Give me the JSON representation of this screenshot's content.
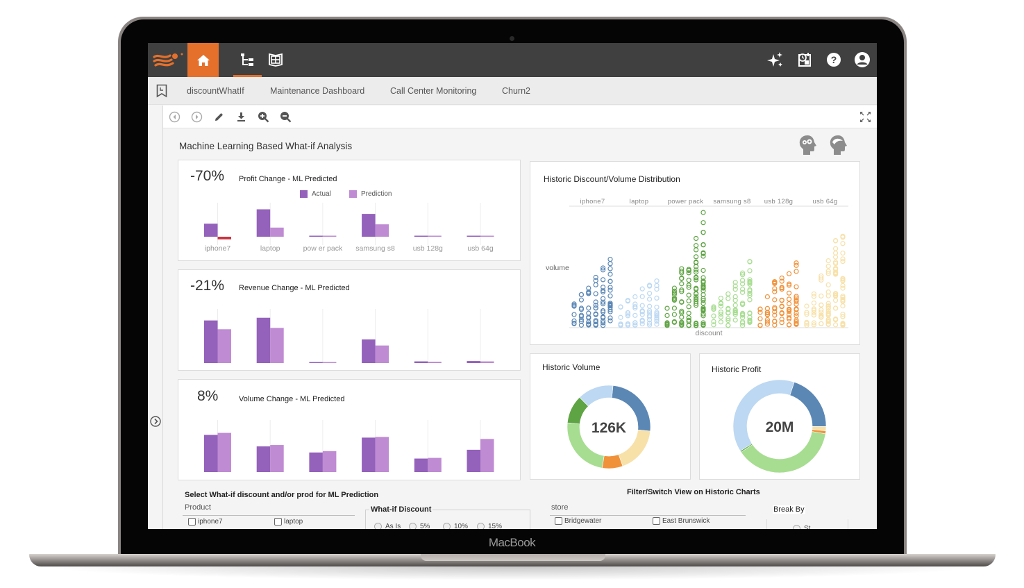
{
  "device": {
    "label": "MacBook"
  },
  "topbar": {
    "icons": [
      "logo-icon",
      "home-icon",
      "repository-tree-icon",
      "dashboard-book-icon",
      "sparkle-ai-icon",
      "schedule-icon",
      "help-icon",
      "user-icon"
    ]
  },
  "tabs": [
    {
      "label": "discountWhatIf"
    },
    {
      "label": "Maintenance Dashboard"
    },
    {
      "label": "Call Center Monitoring"
    },
    {
      "label": "Churn2"
    }
  ],
  "toolbar": {
    "tools": [
      "back",
      "forward",
      "edit",
      "download",
      "zoom-in",
      "zoom-out",
      "fullscreen"
    ]
  },
  "page": {
    "title": "Machine Learning Based What-if Analysis"
  },
  "colors": {
    "accent": "#e4702c",
    "topbar": "#404040",
    "actual": "#9461bb",
    "prediction": "#bf8bd3",
    "negative": "#c9343f",
    "products": [
      "#5b87b5",
      "#bcd8f2",
      "#5fa444",
      "#a7dd91",
      "#f0923a",
      "#f7e1a9"
    ]
  },
  "categories": [
    "iphone7",
    "laptop",
    "pow er pack",
    "samsung s8",
    "usb 128g",
    "usb 64g"
  ],
  "legend": {
    "actual": "Actual",
    "prediction": "Prediction"
  },
  "chart_data": [
    {
      "type": "bar",
      "title": "Profit Change - ML Predicted",
      "kpi": "-70%",
      "categories": [
        "iphone7",
        "laptop",
        "pow er pack",
        "samsung s8",
        "usb 128g",
        "usb 64g"
      ],
      "series": [
        {
          "name": "Actual",
          "values": [
            20,
            42,
            0,
            35,
            0.6,
            1
          ]
        },
        {
          "name": "Prediction",
          "values": [
            -4,
            14,
            0.8,
            19,
            0.2,
            0.8
          ]
        }
      ],
      "ylim": [
        -5,
        50
      ]
    },
    {
      "type": "bar",
      "title": "Revenue Change - ML Predicted",
      "kpi": "-21%",
      "categories": [
        "iphone7",
        "laptop",
        "pow er pack",
        "samsung s8",
        "usb 128g",
        "usb 64g"
      ],
      "series": [
        {
          "name": "Actual",
          "values": [
            63,
            67,
            1.2,
            35,
            2.5,
            3
          ]
        },
        {
          "name": "Prediction",
          "values": [
            50,
            52,
            1.2,
            26,
            2,
            2.5
          ]
        }
      ],
      "ylim": [
        0,
        78
      ]
    },
    {
      "type": "bar",
      "title": "Volume Change - ML Predicted",
      "kpi": "8%",
      "categories": [
        "iphone7",
        "laptop",
        "pow er pack",
        "samsung s8",
        "usb 128g",
        "usb 64g"
      ],
      "series": [
        {
          "name": "Actual",
          "values": [
            55,
            38,
            29,
            51,
            20,
            33
          ]
        },
        {
          "name": "Prediction",
          "values": [
            58,
            40,
            31,
            52,
            21,
            49
          ]
        }
      ],
      "ylim": [
        0,
        75
      ]
    },
    {
      "type": "scatter",
      "title": "Historic Discount/Volume Distribution",
      "xlabel": "discount",
      "ylabel": "volume",
      "facets": [
        "iphone7",
        "laptop",
        "power pack",
        "samsung s8",
        "usb 128g",
        "usb 64g"
      ],
      "series": [
        {
          "name": "iphone7",
          "columns_max_volume": [
            30,
            43,
            52,
            67,
            80,
            92
          ]
        },
        {
          "name": "laptop",
          "columns_max_volume": [
            26,
            35,
            40,
            51,
            56,
            62
          ]
        },
        {
          "name": "power pack",
          "columns_max_volume": [
            24,
            52,
            79,
            78,
            121,
            157
          ]
        },
        {
          "name": "samsung s8",
          "columns_max_volume": [
            26,
            38,
            44,
            60,
            73,
            89
          ]
        },
        {
          "name": "usb 128g",
          "columns_max_volume": [
            23,
            40,
            61,
            66,
            72,
            87
          ]
        },
        {
          "name": "usb 64g",
          "columns_max_volume": [
            27,
            44,
            69,
            90,
            118,
            124
          ]
        }
      ]
    },
    {
      "type": "pie",
      "title": "Historic Volume",
      "center_label": "126K",
      "labels": [
        "iphone7",
        "usb 64g",
        "usb 128g",
        "samsung s8",
        "power pack",
        "laptop"
      ],
      "values": [
        25,
        18,
        8,
        24,
        11,
        14
      ]
    },
    {
      "type": "pie",
      "title": "Historic Profit",
      "center_label": "20M",
      "labels": [
        "iphone7",
        "usb 64g",
        "usb 128g",
        "samsung s8",
        "power pack",
        "laptop"
      ],
      "values": [
        20,
        1.5,
        1,
        38,
        0.5,
        39
      ]
    }
  ],
  "prediction_panel": {
    "title": "Select What-if discount and/or prod for ML Prediction",
    "product_label": "Product",
    "products": [
      "iphone7",
      "laptop"
    ],
    "discount_label": "What-if Discount",
    "discount_options": [
      "As Is",
      "5%",
      "10%",
      "15%"
    ]
  },
  "filter_panel": {
    "title": "Filter/Switch View on Historic Charts",
    "store_label": "store",
    "stores": [
      "Bridgewater",
      "East Brunswick"
    ],
    "break_by_label": "Break By",
    "break_by_option": "St"
  }
}
